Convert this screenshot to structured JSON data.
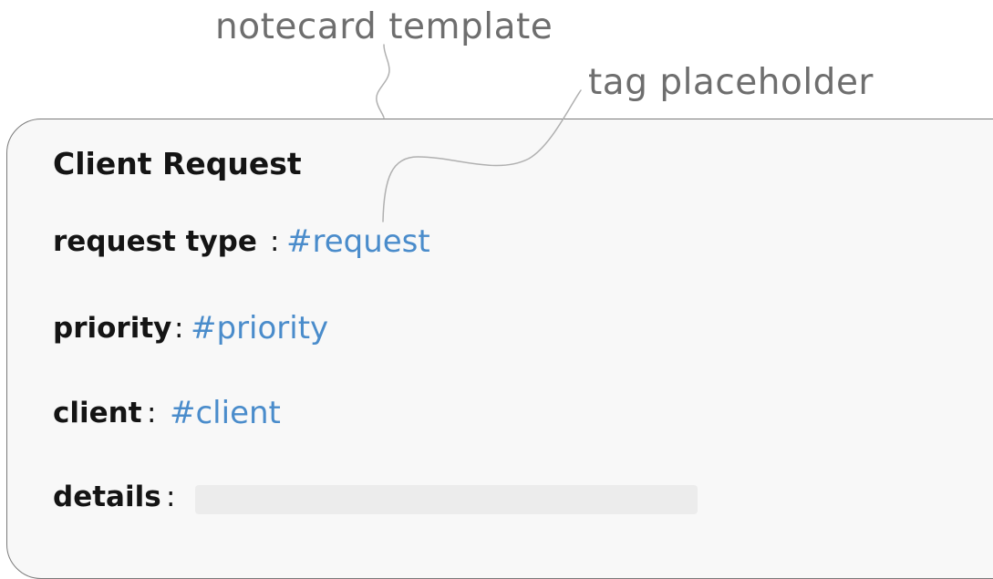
{
  "callouts": {
    "template": "notecard template",
    "tag": "tag placeholder"
  },
  "card": {
    "title": "Client Request",
    "fields": [
      {
        "label": "request type",
        "colon": ":",
        "tag": "#request"
      },
      {
        "label": "priority",
        "colon": ":",
        "tag": "#priority"
      },
      {
        "label": "client",
        "colon": ":",
        "tag": "#client"
      },
      {
        "label": "details",
        "colon": ":",
        "value": ""
      }
    ]
  },
  "colors": {
    "tag": "#4a8ccb",
    "callout_text": "#6e6e6e",
    "card_border": "#7a7a7a",
    "card_background": "#f8f8f8",
    "details_field": "#ececec"
  }
}
